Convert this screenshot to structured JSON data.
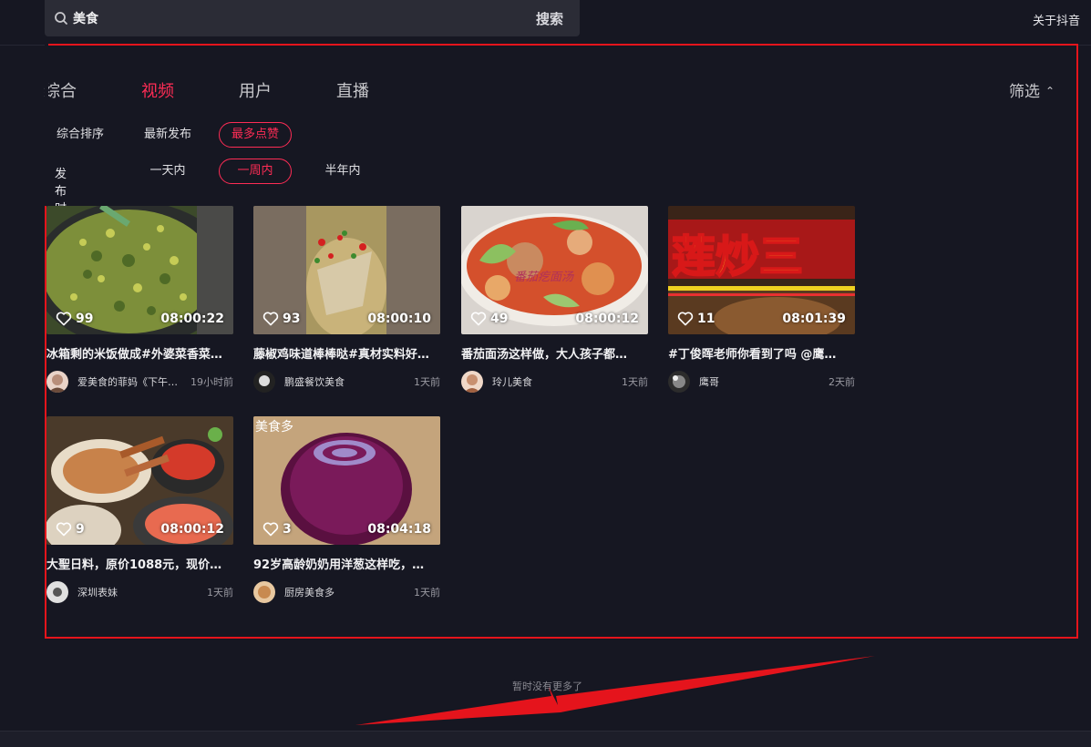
{
  "header": {
    "search_value": "美食",
    "search_button": "搜索",
    "about_link": "关于抖音"
  },
  "tabs": [
    {
      "label": "综合",
      "active": false
    },
    {
      "label": "视频",
      "active": true
    },
    {
      "label": "用户",
      "active": false
    },
    {
      "label": "直播",
      "active": false
    }
  ],
  "filter_toggle": "筛选",
  "sort_row": [
    "综合排序",
    "最新发布",
    "最多点赞"
  ],
  "sort_selected": "最多点赞",
  "time_row": {
    "label": "发布时间",
    "options": [
      "一天内",
      "一周内",
      "半年内"
    ],
    "selected": "一周内"
  },
  "videos": [
    {
      "likes": "99",
      "duration": "08:00:22",
      "title": "冰箱剩的米饭做成#外婆菜香菜…",
      "author": "爱美食的菲妈《下午…",
      "time": "19小时前"
    },
    {
      "likes": "93",
      "duration": "08:00:10",
      "title": "藤椒鸡味道棒棒哒#真材实料好…",
      "author": "鹏盛餐饮美食",
      "time": "1天前"
    },
    {
      "likes": "49",
      "duration": "08:00:12",
      "title": "番茄面汤这样做，大人孩子都…",
      "author": "玲儿美食",
      "time": "1天前",
      "overlay_text": "番茄疙面汤"
    },
    {
      "likes": "11",
      "duration": "08:01:39",
      "title": "#丁俊晖老师你看到了吗 @鹰…",
      "author": "鹰哥",
      "time": "2天前",
      "overlay_text": "莲炒三"
    },
    {
      "likes": "9",
      "duration": "08:00:12",
      "title": "大聖日料，原价1088元，现价…",
      "author": "深圳表妹",
      "time": "1天前"
    },
    {
      "likes": "3",
      "duration": "08:04:18",
      "title": "92岁高龄奶奶用洋葱这样吃，…",
      "author": "厨房美食多",
      "time": "1天前",
      "overlay_text": "美食多"
    }
  ],
  "end_message": "暂时没有更多了",
  "colors": {
    "accent": "#fe2c55",
    "background": "#161722",
    "annotation": "#e5141c"
  }
}
